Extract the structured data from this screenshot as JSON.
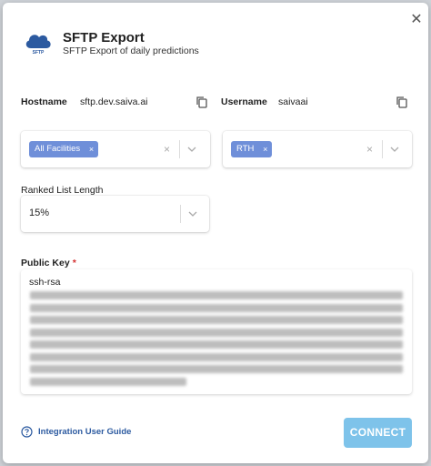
{
  "dialog": {
    "logo_text": "SFTP",
    "title": "SFTP Export",
    "subtitle": "SFTP Export of daily predictions"
  },
  "hostname": {
    "label": "Hostname",
    "value": "sftp.dev.saiva.ai"
  },
  "username": {
    "label": "Username",
    "value": "saivaai"
  },
  "facilities_select": {
    "chip": "All Facilities",
    "chip_remove": "×",
    "clear": "×"
  },
  "type_select": {
    "chip": "RTH",
    "chip_remove": "×",
    "clear": "×"
  },
  "ranked_list": {
    "label": "Ranked List Length",
    "value": "15%"
  },
  "public_key": {
    "label": "Public Key",
    "required_mark": "*",
    "value": "ssh-rsa"
  },
  "footer": {
    "guide_label": "Integration User Guide",
    "connect_label": "CONNECT"
  },
  "icons": {
    "close": "close-icon",
    "cloud": "cloud-icon",
    "copy": "copy-icon",
    "chevron": "chevron-down-icon",
    "help": "help-circle-icon"
  },
  "colors": {
    "chip_bg": "#6f8fd9",
    "connect_bg": "#7ec3ea",
    "link": "#2c5aa0",
    "required": "#d32f2f"
  }
}
